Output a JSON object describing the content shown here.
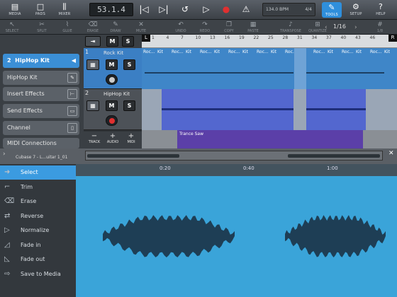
{
  "topbar": {
    "media": "MEDIA",
    "pads": "PADS",
    "mixer": "MIXER",
    "position": "53.1.4",
    "tempo": "134.0 BPM",
    "signature": "4/4",
    "tools": "TOOLS",
    "setup": "SETUP",
    "help": "HELP"
  },
  "toolbar2": {
    "select": "SELECT",
    "split": "SPLIT",
    "glue": "GLUE",
    "erase": "ERASE",
    "draw": "DRAW",
    "mute": "MUTE",
    "undo": "UNDO",
    "redo": "REDO",
    "copy": "COPY",
    "paste": "PASTE",
    "transpose": "TRANSPOSE",
    "quantize": "QUANTIZE",
    "pager": "1/16",
    "grid": "1/8"
  },
  "tracklist": {
    "selected_num": "2",
    "selected_name": "HipHop Kit",
    "items": [
      "HipHop Kit",
      "Insert Effects",
      "Send Effects",
      "Channel",
      "MIDI Connections"
    ],
    "track_add": "TRACK",
    "audio_add": "AUDIO",
    "midi_add": "MIDI"
  },
  "tracks": [
    {
      "num": "1",
      "name": "Rock Kit",
      "m": "M",
      "s": "S"
    },
    {
      "num": "2",
      "name": "HipHop Kit",
      "m": "M",
      "s": "S"
    }
  ],
  "ruler": {
    "marks": [
      "1",
      "4",
      "7",
      "10",
      "13",
      "16",
      "19",
      "22",
      "25",
      "28",
      "31",
      "34",
      "37",
      "40",
      "43",
      "46"
    ],
    "left": "L",
    "right": "R"
  },
  "clips": {
    "rock": "Roc...",
    "kit": "Kit",
    "trance": "Trance Saw"
  },
  "editor": {
    "clip_name": "Cubase 7 - L...uitar 1_01",
    "ruler": [
      "0:20",
      "0:40",
      "1:00"
    ],
    "close": "✕",
    "items": [
      "Select",
      "Trim",
      "Erase",
      "Reverse",
      "Normalize",
      "Fade in",
      "Fade out",
      "Save to Media"
    ],
    "icons": [
      "arrow-icon",
      "trim-icon",
      "erase-icon",
      "reverse-icon",
      "normalize-icon",
      "fade-in-icon",
      "fade-out-icon",
      "save-icon"
    ]
  },
  "colors": {
    "accent": "#3b9be0",
    "wave_bg": "#3aa4d9",
    "wave": "#1e3e55",
    "clip1": "#4a8fd0",
    "clip2": "#5b6fd4"
  }
}
